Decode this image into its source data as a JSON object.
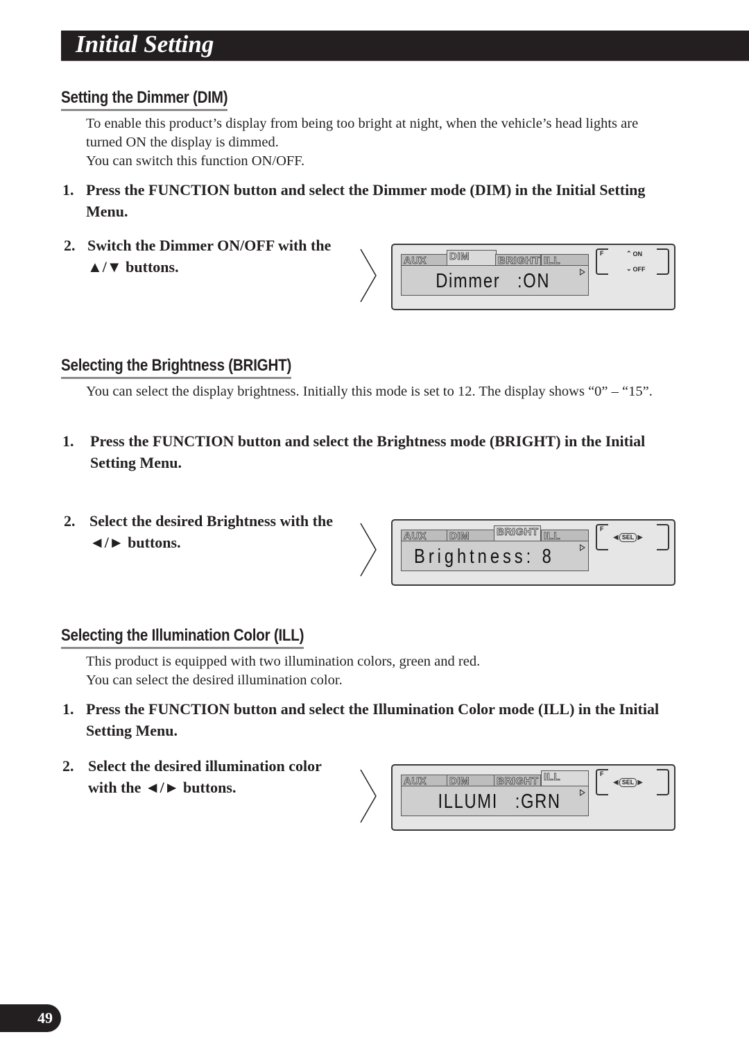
{
  "header": {
    "title": "Initial Setting"
  },
  "sections": [
    {
      "heading": "Setting the Dimmer (DIM)",
      "paragraphs": [
        "To enable this product’s display from being too bright at night, when the vehicle’s head lights are turned ON the display is dimmed.",
        "You can switch this function ON/OFF."
      ],
      "steps": [
        {
          "number": "1.",
          "text": "Press the FUNCTION button and select the Dimmer mode (DIM) in the Initial Setting Menu."
        },
        {
          "number": "2.",
          "text": "Switch the Dimmer ON/OFF with the ▲/▼ buttons."
        }
      ],
      "display": {
        "tabs": [
          "AUX",
          "DIM",
          "BRIGHT",
          "ILL"
        ],
        "active_tab": "DIM",
        "readout": "Dimmer   :ON",
        "key_label": "F",
        "keys": {
          "up": "ON",
          "down": "OFF"
        }
      }
    },
    {
      "heading": "Selecting the Brightness (BRIGHT)",
      "paragraphs": [
        "You can select the display brightness. Initially this mode is set to 12. The display shows “0” – “15”."
      ],
      "steps": [
        {
          "number": "1.",
          "text": "Press the FUNCTION button and select the Brightness mode (BRIGHT) in the Initial Setting Menu."
        },
        {
          "number": "2.",
          "text": "Select the desired Brightness with the ◄/► buttons."
        }
      ],
      "display": {
        "tabs": [
          "AUX",
          "DIM",
          "BRIGHT",
          "ILL"
        ],
        "active_tab": "BRIGHT",
        "readout": "Brightness: 8",
        "key_label": "F",
        "keys": {
          "select": "SEL"
        }
      }
    },
    {
      "heading": "Selecting the Illumination Color (ILL)",
      "paragraphs": [
        "This product is equipped with two illumination colors, green and red.",
        "You can select the desired illumination color."
      ],
      "steps": [
        {
          "number": "1.",
          "text": "Press the FUNCTION button and select the Illumination Color mode (ILL) in the Initial Setting Menu."
        },
        {
          "number": "2.",
          "text": "Select the desired illumination color with the ◄/► buttons."
        }
      ],
      "display": {
        "tabs": [
          "AUX",
          "DIM",
          "BRIGHT",
          "ILL"
        ],
        "active_tab": "ILL",
        "readout": "ILLUMI   :GRN",
        "key_label": "F",
        "keys": {
          "select": "SEL"
        }
      }
    }
  ],
  "footer": {
    "page_number": "49"
  },
  "colors": {
    "header_bg": "#231f20",
    "lcd_bg": "#e6e6e6",
    "lcd_screen": "#cfcfcf",
    "heading_rule": "#8a8a8a"
  }
}
